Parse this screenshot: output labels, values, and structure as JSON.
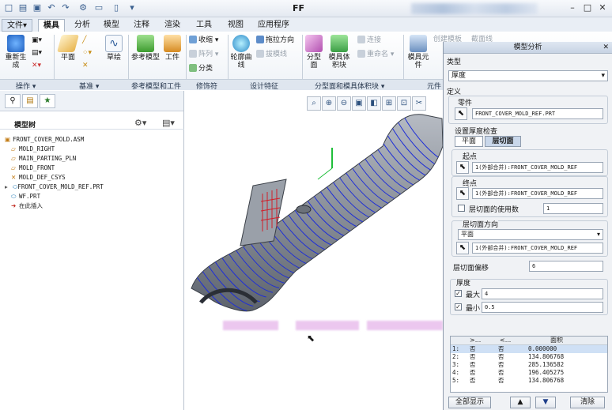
{
  "window": {
    "title": "FF",
    "min": "–",
    "max": "□",
    "close": "✕"
  },
  "quick_access": [
    "□",
    "📂",
    "💾",
    "↶",
    "↷",
    "⚙",
    "▭",
    "📁",
    "▼"
  ],
  "tabs": [
    {
      "label": "文件",
      "suffix": "▾"
    },
    {
      "label": "模具"
    },
    {
      "label": "分析"
    },
    {
      "label": "模型"
    },
    {
      "label": "注释"
    },
    {
      "label": "渲染"
    },
    {
      "label": "工具"
    },
    {
      "label": "视图"
    },
    {
      "label": "应用程序"
    }
  ],
  "ribbon": {
    "regenerate": "重新生成",
    "plane": "平面",
    "sketch": "草绘",
    "ref_model": "参考模型",
    "workpiece": "工件",
    "shrink": "收缩",
    "pattern": "阵列",
    "classify": "分类",
    "contour_curve": "轮廓曲线",
    "draw_direction": "拖拉方向",
    "draft_check": "拔模线",
    "parting_surface": "分型面",
    "mold_volume": "模具体积块",
    "connect": "连接",
    "rename": "重命名",
    "mold_component": "模具元件",
    "create_template": "创建模板",
    "section": "截面线",
    "groups": {
      "operations": "操作",
      "datum": "基准",
      "ref_model_group": "参考模型和工件",
      "modifiers": "修饰符",
      "design_features": "设计特征",
      "parting_volume": "分型面和模具体积块",
      "components": "元件"
    }
  },
  "tree": {
    "header": "模型树",
    "items": [
      {
        "label": "FRONT_COVER_MOLD.ASM",
        "icon": "▣"
      },
      {
        "label": "MOLD_RIGHT",
        "icon": "▱"
      },
      {
        "label": "MAIN_PARTING_PLN",
        "icon": "▱"
      },
      {
        "label": "MOLD_FRONT",
        "icon": "▱"
      },
      {
        "label": "MOLD_DEF_CSYS",
        "icon": "✕"
      },
      {
        "label": "FRONT_COVER_MOLD_REF.PRT",
        "icon": "▸"
      },
      {
        "label": "WF.PRT",
        "icon": "⬭"
      },
      {
        "label": "在此插入",
        "icon": "➜"
      }
    ]
  },
  "view_toolbar": [
    "⌕",
    "⊕",
    "⊖",
    "▣",
    "◧",
    "⊞",
    "⊡",
    "✂"
  ],
  "dialog": {
    "title": "模型分析",
    "type_label": "类型",
    "type_value": "厚度",
    "definition_label": "定义",
    "part_label": "零件",
    "part_value": "FRONT_COVER_MOLD_REF.PRT",
    "set_check_label": "设置厚度检查",
    "seg_plane": "平面",
    "seg_slice": "层切面",
    "start_label": "起点",
    "start_value": "1(外部合并):FRONT_COVER_MOLD_REF",
    "end_label": "终点",
    "end_value": "1(外部合并):FRONT_COVER_MOLD_REF",
    "slice_count_label": "层切面的使用数",
    "slice_count_value": "1",
    "slice_dir_label": "层切面方向",
    "slice_dir_type": "平面",
    "slice_dir_value": "1(外部合并):FRONT_COVER_MOLD_REF",
    "offset_label": "层切面偏移",
    "offset_value": "6",
    "thickness_label": "厚度",
    "max_label": "最大",
    "max_value": "4",
    "min_label": "最小",
    "min_value": "0.5",
    "table_header": {
      "c1": ">...",
      "c2": "<...",
      "c3": "面积"
    },
    "rows": [
      {
        "idx": "1:",
        "a": "否",
        "b": "否",
        "area": "0.000000"
      },
      {
        "idx": "2:",
        "a": "否",
        "b": "否",
        "area": "134.806768"
      },
      {
        "idx": "3:",
        "a": "否",
        "b": "否",
        "area": "285.136582"
      },
      {
        "idx": "4:",
        "a": "否",
        "b": "否",
        "area": "196.405275"
      },
      {
        "idx": "5:",
        "a": "否",
        "b": "否",
        "area": "134.806768"
      }
    ],
    "show_all": "全部显示",
    "clear": "清除"
  },
  "colors": {
    "mesh": "#1f2fd6",
    "part": "#8a8f98",
    "accent": "#2b5a9a",
    "datum_green": "#1fbf3a"
  }
}
